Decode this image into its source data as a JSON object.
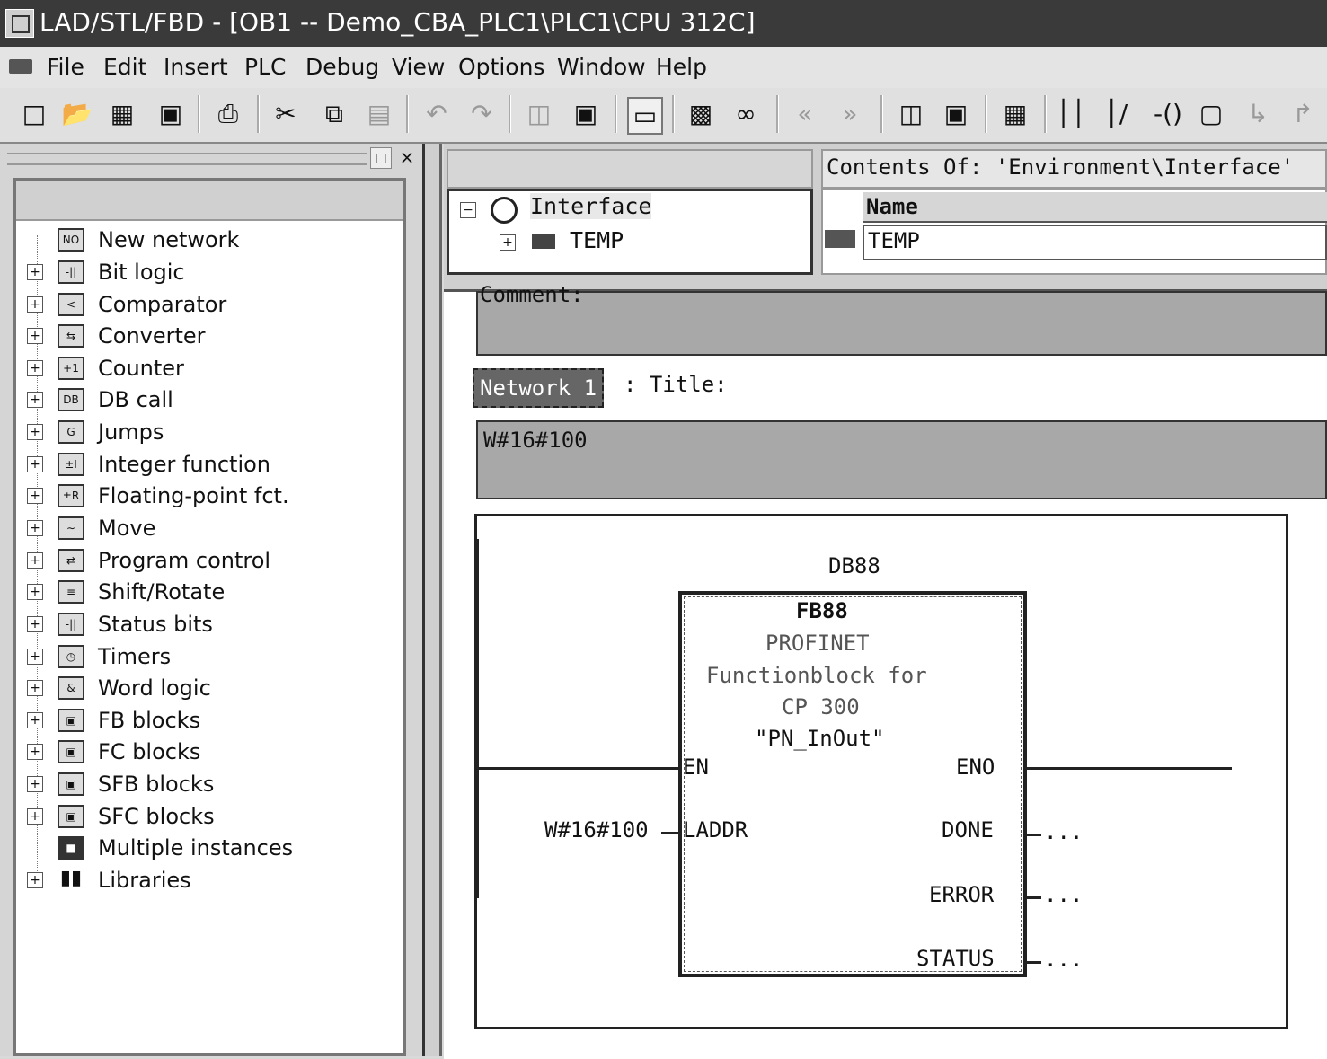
{
  "window": {
    "title": "LAD/STL/FBD  - [OB1 -- Demo_CBA_PLC1\\PLC1\\CPU 312C]"
  },
  "menu": [
    "File",
    "Edit",
    "Insert",
    "PLC",
    "Debug",
    "View",
    "Options",
    "Window",
    "Help"
  ],
  "toolbar": {
    "new": "new-icon",
    "open": "open-icon",
    "save": "save-icon",
    "print": "print-icon",
    "cut": "cut-icon",
    "copy": "copy-icon",
    "paste": "paste-icon",
    "undo": "undo-icon",
    "redo": "redo-icon",
    "contact_no": "normally-open-contact-icon",
    "contact_nc": "normally-closed-contact-icon",
    "coil": "coil-icon",
    "box": "empty-box-icon"
  },
  "program_elements": {
    "items": [
      {
        "label": "New network",
        "expandable": false,
        "icon": "network-icon"
      },
      {
        "label": "Bit logic",
        "expandable": true,
        "icon": "bit-logic-icon"
      },
      {
        "label": "Comparator",
        "expandable": true,
        "icon": "comparator-icon"
      },
      {
        "label": "Converter",
        "expandable": true,
        "icon": "converter-icon"
      },
      {
        "label": "Counter",
        "expandable": true,
        "icon": "counter-icon"
      },
      {
        "label": "DB call",
        "expandable": true,
        "icon": "db-call-icon"
      },
      {
        "label": "Jumps",
        "expandable": true,
        "icon": "jumps-icon"
      },
      {
        "label": "Integer function",
        "expandable": true,
        "icon": "integer-icon"
      },
      {
        "label": "Floating-point fct.",
        "expandable": true,
        "icon": "float-icon"
      },
      {
        "label": "Move",
        "expandable": true,
        "icon": "move-icon"
      },
      {
        "label": "Program control",
        "expandable": true,
        "icon": "program-control-icon"
      },
      {
        "label": "Shift/Rotate",
        "expandable": true,
        "icon": "shift-rotate-icon"
      },
      {
        "label": "Status bits",
        "expandable": true,
        "icon": "status-bits-icon"
      },
      {
        "label": "Timers",
        "expandable": true,
        "icon": "timer-icon"
      },
      {
        "label": "Word logic",
        "expandable": true,
        "icon": "word-logic-icon"
      },
      {
        "label": "FB blocks",
        "expandable": true,
        "icon": "block-icon"
      },
      {
        "label": "FC blocks",
        "expandable": true,
        "icon": "block-icon"
      },
      {
        "label": "SFB blocks",
        "expandable": true,
        "icon": "block-icon"
      },
      {
        "label": "SFC blocks",
        "expandable": true,
        "icon": "block-icon"
      },
      {
        "label": "Multiple instances",
        "expandable": false,
        "icon": "multi-instance-icon"
      },
      {
        "label": "Libraries",
        "expandable": true,
        "icon": "library-icon"
      }
    ]
  },
  "interface": {
    "root": "Interface",
    "child": "TEMP",
    "contents_title": "Contents Of: 'Environment\\Interface'",
    "column_name": "Name",
    "row": "TEMP"
  },
  "editor": {
    "comment_label": "Comment:",
    "network_label": "Network 1",
    "network_title": ": Title:",
    "network_comment": "W#16#100",
    "block": {
      "instance_db": "DB88",
      "fb": "FB88",
      "desc1": "PROFINET",
      "desc2": "Functionblock for",
      "desc3": "CP 300",
      "symbol": "\"PN_InOut\"",
      "in_en": "EN",
      "in_laddr": "LADDR",
      "out_eno": "ENO",
      "out_done": "DONE",
      "out_error": "ERROR",
      "out_status": "STATUS",
      "laddr_value": "W#16#100",
      "done_value": "...",
      "error_value": "...",
      "status_value": "..."
    }
  }
}
